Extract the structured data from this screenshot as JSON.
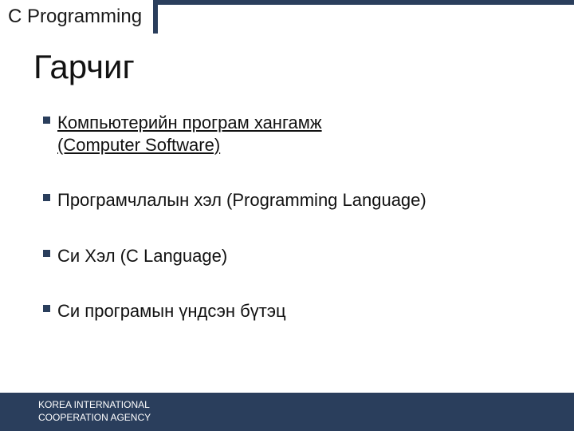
{
  "header": {
    "tab": "C Programming"
  },
  "title": "Гарчиг",
  "bullets": [
    {
      "line1": "Компьютерийн програм хангамж",
      "line2": "(Computer Software)",
      "active": true
    },
    {
      "line1": "Програмчлалын хэл (Programming Language)",
      "line2": "",
      "active": false
    },
    {
      "line1": "Си Хэл (C Language)",
      "line2": "",
      "active": false
    },
    {
      "line1": "Си програмын үндсэн бүтэц",
      "line2": "",
      "active": false
    }
  ],
  "footer": {
    "line1": "KOREA INTERNATIONAL",
    "line2": "COOPERATION AGENCY"
  }
}
